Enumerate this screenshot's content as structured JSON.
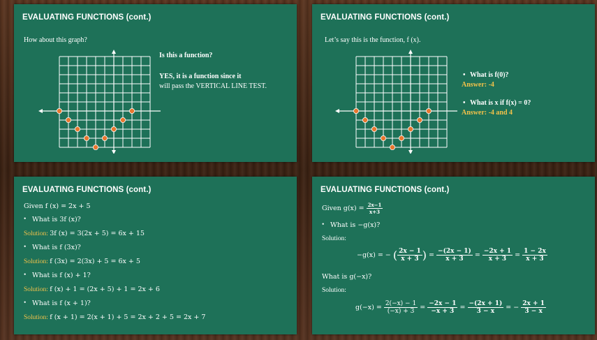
{
  "slide1": {
    "title": "EVALUATING FUNCTIONS (cont.)",
    "subtitle": "How about this graph?",
    "question": "Is this a function?",
    "answer_line1": "YES, it is a function since it",
    "answer_line2": "will pass the VERTICAL LINE TEST."
  },
  "slide2": {
    "title": "EVALUATING FUNCTIONS (cont.)",
    "subtitle": "Let’s say this is the function, f (x).",
    "q1": "What is f(0)?",
    "a1": "Answer: -4",
    "q2": "What is x if f(x) = 0?",
    "a2": "Answer: -4 and 4"
  },
  "slide3": {
    "title": "EVALUATING FUNCTIONS (cont.)",
    "given": "Given f (x) = 2x + 5",
    "q1": "What is 3f (x)?",
    "s1_label": "Solution:",
    "s1": "3f (x) = 3(2x + 5) = 6x + 15",
    "q2": "What is f (3x)?",
    "s2_label": "Solution:",
    "s2": "f (3x) = 2(3x) + 5 = 6x + 5",
    "q3": "What is f (x) + 1?",
    "s3_label": "Solution:",
    "s3": "f (x) + 1 = (2x + 5) + 1 = 2x + 6",
    "q4": "What is f (x + 1)?",
    "s4_label": "Solution:",
    "s4": "f (x + 1) = 2(x + 1) + 5 = 2x + 2 + 5 = 2x + 7"
  },
  "slide4": {
    "title": "EVALUATING FUNCTIONS (cont.)",
    "given_prefix": "Given g(x) =",
    "given_num": "2x−1",
    "given_den": "x+3",
    "q1": "What is −g(x)?",
    "sol1_label": "Solution:",
    "eq1_lhs": "−g(x) = −",
    "eq1_f1_num": "2x − 1",
    "eq1_f1_den": "x + 3",
    "eq1_f2_num": "−(2x − 1)",
    "eq1_f2_den": "x + 3",
    "eq1_f3_num": "−2x + 1",
    "eq1_f3_den": "x + 3",
    "eq1_f4_num": "1 − 2x",
    "eq1_f4_den": "x + 3",
    "q2": "What is g(−x)?",
    "sol2_label": "Solution:",
    "eq2_lhs": "g(−x) =",
    "eq2_f1_num": "2(−x) − 1",
    "eq2_f1_den": "(−x) + 3",
    "eq2_f2_num": "−2x − 1",
    "eq2_f2_den": "−x + 3",
    "eq2_f3_num": "−(2x + 1)",
    "eq2_f3_den": "3 − x",
    "eq2_f4_prefix": "= −",
    "eq2_f4_num": "2x + 1",
    "eq2_f4_den": "3 − x",
    "eq_sign": "="
  },
  "graph": {
    "points": [
      [
        -6,
        0
      ],
      [
        -5,
        -1
      ],
      [
        -4,
        -2
      ],
      [
        -3,
        -3
      ],
      [
        -2,
        -4
      ],
      [
        -1,
        -3
      ],
      [
        0,
        -2
      ],
      [
        1,
        -1
      ],
      [
        2,
        0
      ]
    ],
    "grid_color": "#ffffff",
    "point_fill": "#e8772e"
  },
  "colors": {
    "board": "#1e7158",
    "answer": "#f3c24a"
  }
}
